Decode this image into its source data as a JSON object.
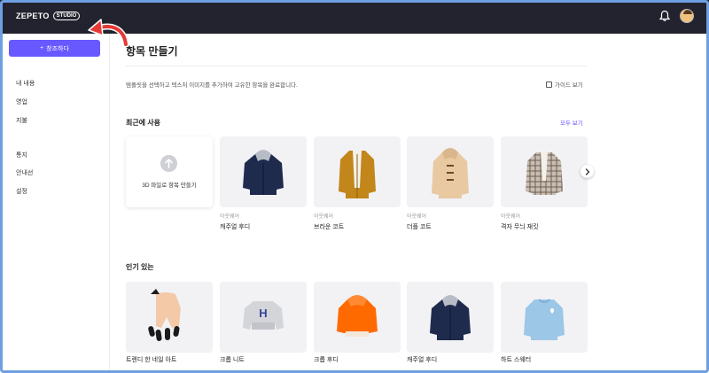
{
  "header": {
    "logo_text": "ZEPETO",
    "logo_badge": "STUDIO",
    "bell_icon": "bell-icon",
    "avatar_icon": "user-avatar"
  },
  "sidebar": {
    "create_button": {
      "icon": "+",
      "label": "창조하다"
    },
    "items": [
      {
        "label": "내 내용"
      },
      {
        "label": "영업"
      },
      {
        "label": "지불"
      },
      {
        "label": "통지"
      },
      {
        "label": "안내선"
      },
      {
        "label": "설정"
      }
    ]
  },
  "main": {
    "title": "항목 만들기",
    "description": "템플릿을 선택하고 텍스처 이미지를 추가하여 고유한 항목을 완료합니다.",
    "guide_link": "가이드 보기",
    "recent": {
      "title": "최근에 사용",
      "see_all": "모두 보기",
      "upload_label": "3D 파일로 항목 만들기",
      "items": [
        {
          "category": "아웃웨어",
          "name": "캐주얼 후디"
        },
        {
          "category": "아웃웨어",
          "name": "브라운 코트"
        },
        {
          "category": "아웃웨어",
          "name": "더플 코트"
        },
        {
          "category": "아웃웨어",
          "name": "격자 무늬 재킷"
        }
      ]
    },
    "popular": {
      "title": "인기 있는",
      "items": [
        {
          "name": "트렌디 한 네일 아트"
        },
        {
          "name": "크롭 니트"
        },
        {
          "name": "크롭 후디"
        },
        {
          "name": "캐주얼 후디"
        },
        {
          "name": "하트 스웨터"
        }
      ]
    }
  },
  "colors": {
    "accent": "#6758ff",
    "header_bg": "#22232e",
    "annotation_arrow": "#e53935"
  }
}
